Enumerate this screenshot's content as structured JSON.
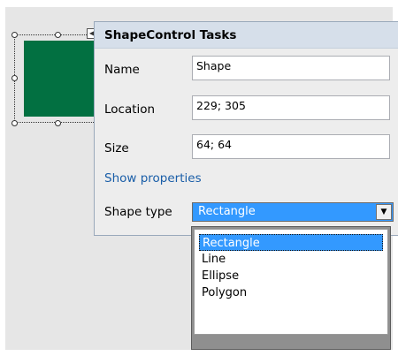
{
  "panel": {
    "title": "ShapeControl Tasks",
    "fields": [
      {
        "label": "Name",
        "value": "Shape"
      },
      {
        "label": "Location",
        "value": "229; 305"
      },
      {
        "label": "Size",
        "value": "64; 64"
      }
    ],
    "link": "Show properties",
    "shape_type": {
      "label": "Shape type",
      "selected": "Rectangle",
      "options": [
        "Rectangle",
        "Line",
        "Ellipse",
        "Polygon"
      ]
    }
  },
  "colors": {
    "shape_fill": "#027041",
    "selection": "#3399ff",
    "header_bg": "#d6dfea",
    "link": "#1a5ea8"
  }
}
